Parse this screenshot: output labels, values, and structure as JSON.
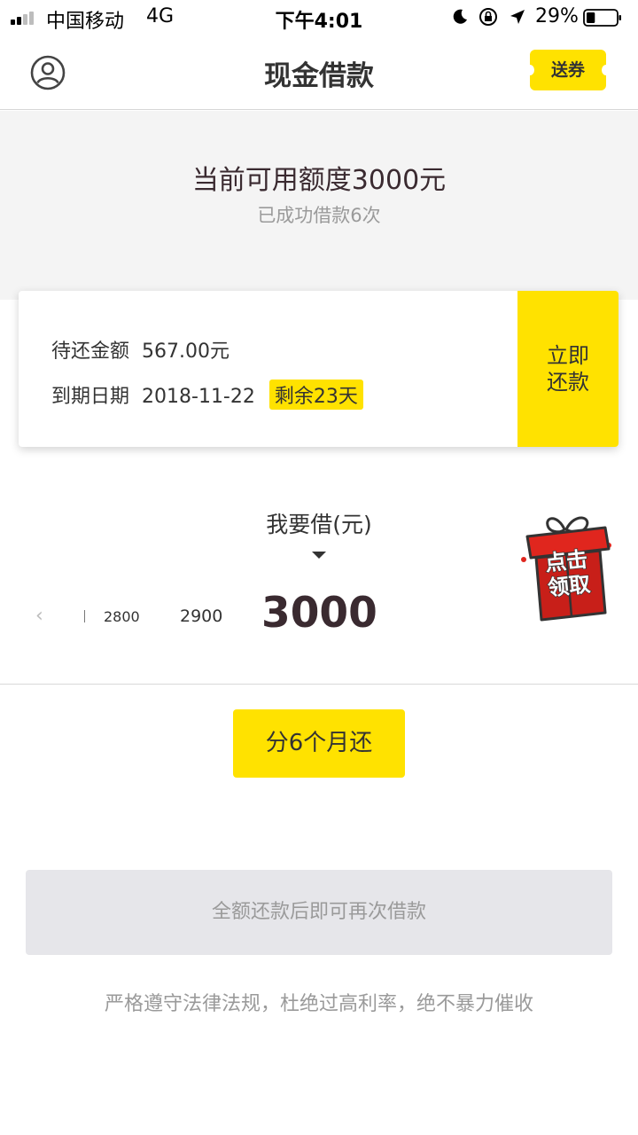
{
  "status_bar": {
    "carrier": "中国移动",
    "network": "4G",
    "time": "下午4:01",
    "battery_percent": "29%",
    "battery_level": 0.29,
    "signal_bars": 2,
    "icons": [
      "signal-icon",
      "moon-icon",
      "orientation-lock-icon",
      "location-icon",
      "battery-icon"
    ]
  },
  "nav": {
    "title": "现金借款",
    "left_icon": "user-icon",
    "coupon_label": "送券"
  },
  "hero": {
    "quota_text": "当前可用额度3000元",
    "borrow_count_text": "已成功借款6次"
  },
  "repayment": {
    "amount_label": "待还金额",
    "amount_value": "567.00元",
    "due_label": "到期日期",
    "due_value": "2018-11-22",
    "remaining_badge": "剩余23天",
    "repay_button": "立即还款"
  },
  "picker": {
    "label": "我要借(元)",
    "prev_symbol": "‹",
    "values": [
      "2800",
      "2900"
    ],
    "selected": "3000"
  },
  "promo": {
    "gift_text_top": "点击",
    "gift_text_bottom": "领取"
  },
  "actions": {
    "installment_button": "分6个月还",
    "reborrow_button": "全额还款后即可再次借款"
  },
  "footer": {
    "compliance_text": "严格遵守法律法规，杜绝过高利率，绝不暴力催收"
  },
  "colors": {
    "accent": "#FFE200",
    "text_dark": "#333333",
    "text_muted": "#9A9A9A",
    "gift_red": "#E0261E"
  }
}
